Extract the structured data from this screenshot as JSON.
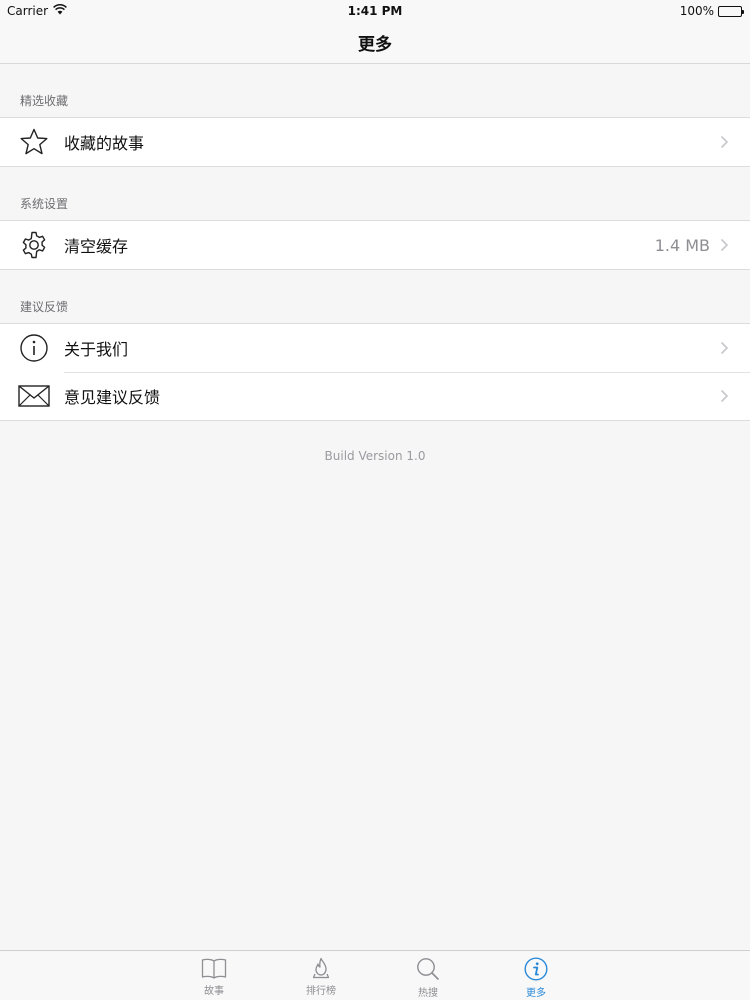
{
  "status": {
    "carrier": "Carrier",
    "time": "1:41 PM",
    "battery": "100%",
    "icons": {
      "wifi": "wifi-icon",
      "battery": "battery-icon"
    }
  },
  "nav": {
    "title": "更多"
  },
  "sections": [
    {
      "header": "精选收藏",
      "items": [
        {
          "label": "收藏的故事",
          "icon": "star-icon",
          "detail": ""
        }
      ]
    },
    {
      "header": "系统设置",
      "items": [
        {
          "label": "清空缓存",
          "icon": "gear-icon",
          "detail": "1.4 MB"
        }
      ]
    },
    {
      "header": "建议反馈",
      "items": [
        {
          "label": "关于我们",
          "icon": "info-icon",
          "detail": ""
        },
        {
          "label": "意见建议反馈",
          "icon": "envelope-icon",
          "detail": ""
        }
      ]
    }
  ],
  "footer": {
    "version": "Build Version 1.0"
  },
  "tabs": [
    {
      "label": "故事",
      "icon": "book-icon",
      "active": false
    },
    {
      "label": "排行榜",
      "icon": "flame-icon",
      "active": false
    },
    {
      "label": "热搜",
      "icon": "search-icon",
      "active": false
    },
    {
      "label": "更多",
      "icon": "info-circle-icon",
      "active": true
    }
  ],
  "colors": {
    "accent": "#2a8ad8",
    "background": "#f7f6f6",
    "section_header": "#6d6d72",
    "detail_text": "#8e8e93",
    "chevron": "#c7c7cc"
  }
}
